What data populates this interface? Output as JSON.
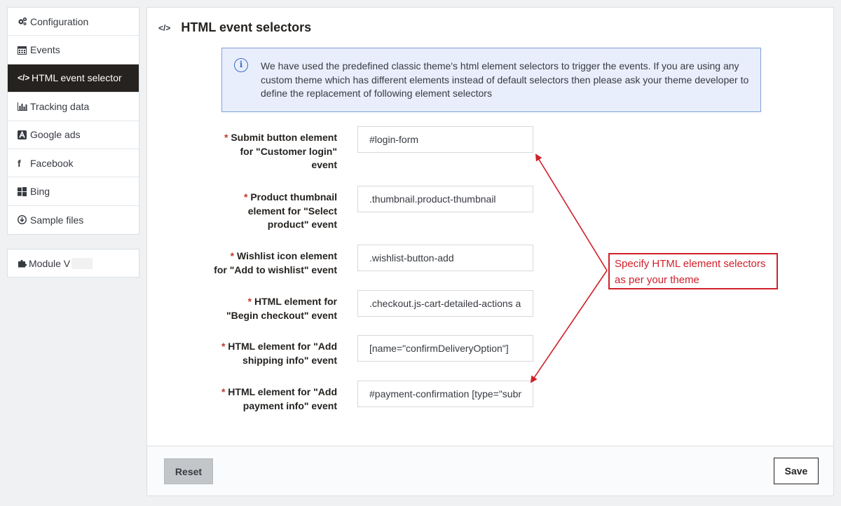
{
  "sidebar": {
    "items": [
      {
        "label": "Configuration",
        "icon": "gears-icon"
      },
      {
        "label": "Events",
        "icon": "calendar-icon"
      },
      {
        "label": "HTML event selector",
        "icon": "code-icon",
        "active": true
      },
      {
        "label": "Tracking data",
        "icon": "bar-chart-icon"
      },
      {
        "label": "Google ads",
        "icon": "google-ads-icon"
      },
      {
        "label": "Facebook",
        "icon": "facebook-icon"
      },
      {
        "label": "Bing",
        "icon": "windows-icon"
      },
      {
        "label": "Sample files",
        "icon": "download-icon"
      }
    ],
    "module_label": "Module V"
  },
  "panel": {
    "title": "HTML event selectors",
    "alert_text": "We have used the predefined classic theme's html element selectors to trigger the events. If you are using any custom theme which has different elements instead of default selectors then please ask your theme developer to define the replacement of following element selectors"
  },
  "form": {
    "fields": [
      {
        "required_mark": "*",
        "label_lines": [
          "Submit button element",
          "for \"Customer login\"",
          "event"
        ],
        "value": "#login-form"
      },
      {
        "required_mark": "*",
        "label_lines": [
          "Product thumbnail",
          "element for \"Select",
          "product\" event"
        ],
        "value": ".thumbnail.product-thumbnail"
      },
      {
        "required_mark": "*",
        "label_lines": [
          "Wishlist icon element",
          "for \"Add to wishlist\" event"
        ],
        "value": ".wishlist-button-add"
      },
      {
        "required_mark": "*",
        "label_lines": [
          "HTML element for",
          "\"Begin checkout\" event"
        ],
        "value": ".checkout.js-cart-detailed-actions a"
      },
      {
        "required_mark": "*",
        "label_lines": [
          "HTML element for \"Add",
          "shipping info\" event"
        ],
        "value": "[name=\"confirmDeliveryOption\"]"
      },
      {
        "required_mark": "*",
        "label_lines": [
          "HTML element for \"Add",
          "payment info\" event"
        ],
        "value": "#payment-confirmation [type=\"submit\"]"
      }
    ]
  },
  "callout": {
    "lines": [
      "Specify HTML element selectors",
      "as per your theme"
    ],
    "color": "#d0202a"
  },
  "footer": {
    "reset_label": "Reset",
    "save_label": "Save"
  },
  "colors": {
    "active_nav_bg": "#25221f",
    "alert_bg": "#e9eefc",
    "alert_border": "#7fa1d8",
    "required": "#c0392b"
  }
}
